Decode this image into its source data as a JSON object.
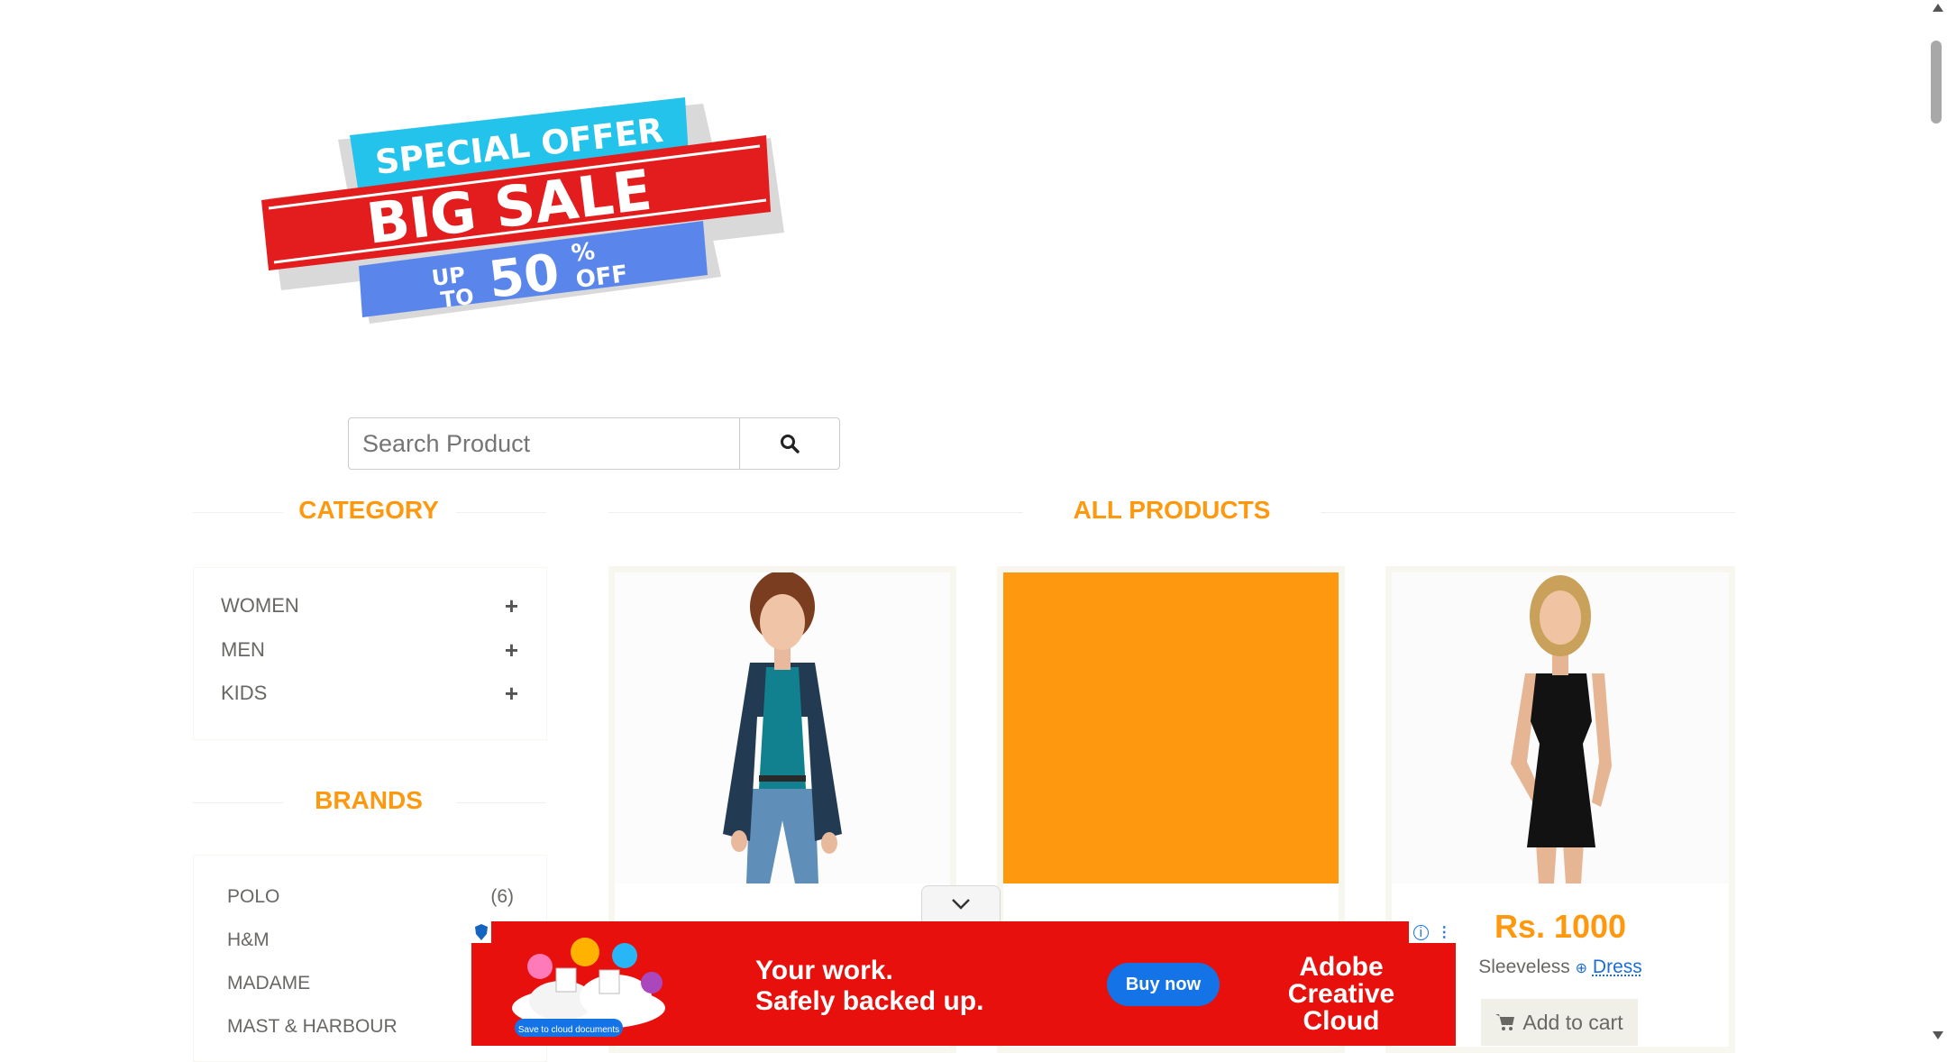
{
  "banner": {
    "line1": "SPECIAL OFFER",
    "line2": "BIG SALE",
    "up": "UP",
    "to": "TO",
    "percent_value": "50",
    "percent_sign": "%",
    "off": "OFF"
  },
  "search": {
    "placeholder": "Search Product"
  },
  "sidebar": {
    "category_title": "CATEGORY",
    "categories": [
      {
        "label": "WOMEN"
      },
      {
        "label": "MEN"
      },
      {
        "label": "KIDS"
      }
    ],
    "brands_title": "BRANDS",
    "brands": [
      {
        "label": "POLO",
        "count": "(6)"
      },
      {
        "label": "H&M",
        "count": ""
      },
      {
        "label": "MADAME",
        "count": ""
      },
      {
        "label": "MAST & HARBOUR",
        "count": ""
      }
    ]
  },
  "main": {
    "title": "ALL PRODUCTS",
    "products": [
      {
        "image": "woman-in-teal-top-and-jeans"
      },
      {
        "image": "orange-placeholder"
      },
      {
        "image": "woman-in-black-sleeveless-dress",
        "price": "Rs. 1000",
        "name": "Sleeveless",
        "link": "Dress",
        "cta": "Add to cart"
      }
    ]
  },
  "ad": {
    "badge": "Save to cloud documents",
    "headline1": "Your work.",
    "headline2": "Safely backed up.",
    "cta": "Buy now",
    "brand1": "Adobe",
    "brand2": "Creative Cloud",
    "colors": {
      "background": "#e8100c",
      "cta": "#1473e6"
    }
  },
  "colors": {
    "accent": "#fe980f",
    "text": "#696763",
    "link": "#1c6ed4"
  }
}
